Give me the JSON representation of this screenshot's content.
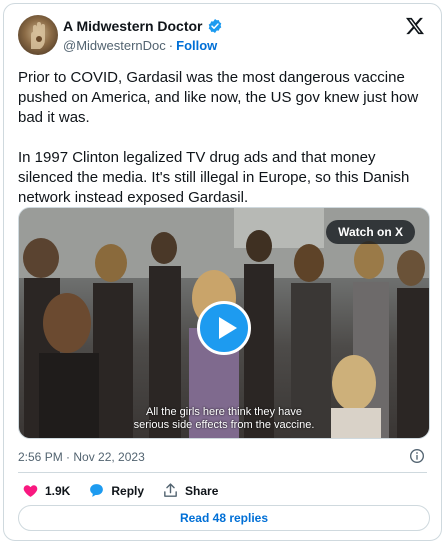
{
  "author": {
    "name": "A Midwestern Doctor",
    "handle": "@MidwesternDoc",
    "separator": "·",
    "follow_label": "Follow"
  },
  "tweet": {
    "paragraphs": [
      "Prior to COVID, Gardasil was the most dangerous vaccine pushed on America, and like now, the US gov knew just how bad it was.",
      "In 1997 Clinton legalized TV drug ads and that money silenced the media. It's still illegal in Europe, so this Danish network instead exposed Gardasil."
    ],
    "timestamp": "2:56 PM · Nov 22, 2023"
  },
  "media": {
    "watch_label": "Watch on X",
    "subtitle_lines": [
      "All the girls here think they have",
      "serious side effects from the vaccine."
    ]
  },
  "actions": {
    "like_count": "1.9K",
    "reply_label": "Reply",
    "share_label": "Share"
  },
  "footer": {
    "read_replies_label": "Read 48 replies"
  },
  "colors": {
    "accent": "#1d9bf0",
    "link": "#006fd6",
    "like": "#f91880"
  }
}
